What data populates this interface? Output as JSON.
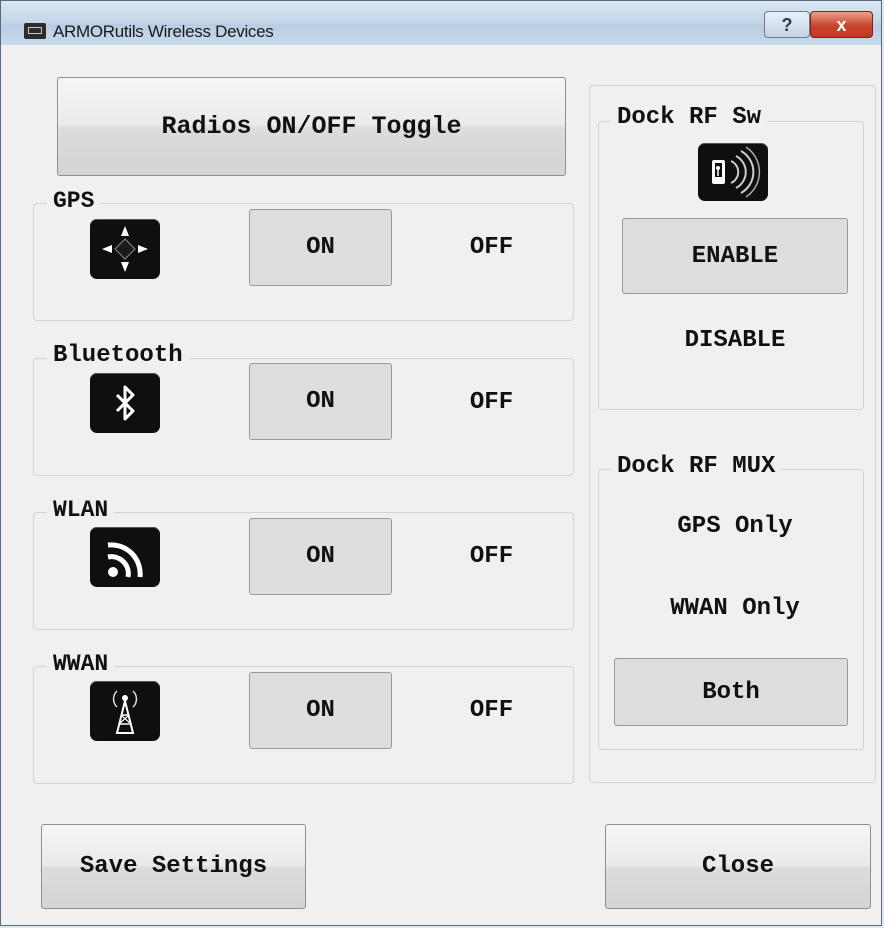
{
  "window": {
    "title": "ARMORutils Wireless Devices",
    "help_label": "?",
    "close_label": "x"
  },
  "main": {
    "toggle_label": "Radios ON/OFF Toggle"
  },
  "radios": {
    "gps": {
      "label": "GPS",
      "on": "ON",
      "off": "OFF",
      "state": "ON",
      "icon": "gps-icon"
    },
    "bluetooth": {
      "label": "Bluetooth",
      "on": "ON",
      "off": "OFF",
      "state": "ON",
      "icon": "bluetooth-icon"
    },
    "wlan": {
      "label": "WLAN",
      "on": "ON",
      "off": "OFF",
      "state": "ON",
      "icon": "wifi-icon"
    },
    "wwan": {
      "label": "WWAN",
      "on": "ON",
      "off": "OFF",
      "state": "ON",
      "icon": "cell-tower-icon"
    }
  },
  "dock_rf_sw": {
    "label": "Dock RF Sw",
    "enable": "ENABLE",
    "disable": "DISABLE",
    "selected": "ENABLE",
    "icon": "rf-switch-icon"
  },
  "dock_rf_mux": {
    "label": "Dock RF MUX",
    "gps_only": "GPS Only",
    "wwan_only": "WWAN Only",
    "both": "Both",
    "selected": "Both"
  },
  "footer": {
    "save_label": "Save Settings",
    "close_label": "Close"
  },
  "colors": {
    "icon_bg": "#0f0f0f",
    "close_button": "#c7452c"
  }
}
